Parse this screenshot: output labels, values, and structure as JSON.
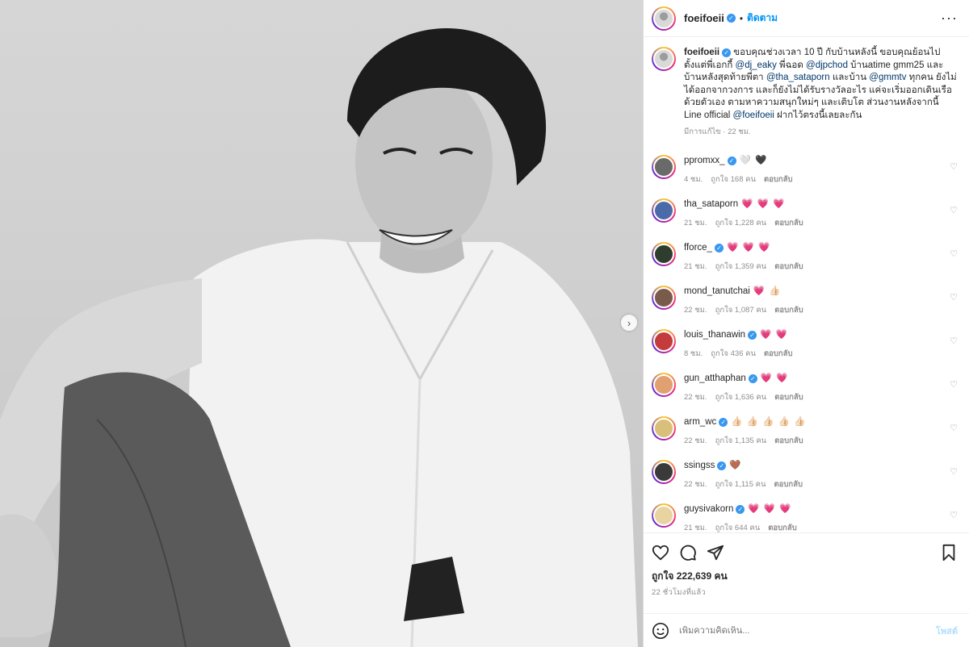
{
  "colors": {
    "accent": "#0095f6",
    "verified": "#3897f0",
    "heart": "#ed4956",
    "muted": "#8e8e8e"
  },
  "header": {
    "username": "foeifoeii",
    "dot": "•",
    "follow_label": "ติดตาม",
    "more_icon": "more-icon"
  },
  "caption": {
    "username": "foeifoeii",
    "parts": [
      "ขอบคุณช่วงเวลา 10 ปี กับบ้านหลังนี้ ขอบคุณย้อนไปตั้งแต่พี่เอกกี้ ",
      "@dj_eaky",
      " พี่ฉอด ",
      "@djpchod",
      " บ้านatime gmm25 และบ้านหลังสุดท้ายพี่ตา ",
      "@tha_sataporn",
      " และบ้าน ",
      "@gmmtv",
      " ทุกคน ยังไม่ได้ออกจากวงการ และก็ยังไม่ได้รับรางวัลอะไร แค่จะเริ่มออกเดินเรือด้วยตัวเอง ตามหาความสนุกใหม่ๆ และเติบโต ส่วนงานหลังจากนี้ Line official ",
      "@foeifoeii",
      " ฝากไว้ตรงนี้เลยละกัน"
    ],
    "edited": "มีการแก้ไข",
    "time": "22 ชม."
  },
  "comments": [
    {
      "user": "ppromxx_",
      "verified": true,
      "text": "🤍 🖤",
      "time": "4 ชม.",
      "likes": "ถูกใจ 168 คน",
      "reply": "ตอบกลับ"
    },
    {
      "user": "tha_sataporn",
      "verified": false,
      "text": "💗 💗 💗",
      "time": "21 ชม.",
      "likes": "ถูกใจ 1,228 คน",
      "reply": "ตอบกลับ"
    },
    {
      "user": "fforce_",
      "verified": true,
      "text": "💗 💗 💗",
      "time": "21 ชม.",
      "likes": "ถูกใจ 1,359 คน",
      "reply": "ตอบกลับ"
    },
    {
      "user": "mond_tanutchai",
      "verified": false,
      "text": "💗 👍🏻",
      "time": "22 ชม.",
      "likes": "ถูกใจ 1,087 คน",
      "reply": "ตอบกลับ"
    },
    {
      "user": "louis_thanawin",
      "verified": true,
      "text": "💗 💗",
      "time": "8 ชม.",
      "likes": "ถูกใจ 436 คน",
      "reply": "ตอบกลับ"
    },
    {
      "user": "gun_atthaphan",
      "verified": true,
      "text": "💗 💗",
      "time": "22 ชม.",
      "likes": "ถูกใจ 1,636 คน",
      "reply": "ตอบกลับ"
    },
    {
      "user": "arm_wc",
      "verified": true,
      "text": "👍🏻 👍🏻 👍🏻 👍🏻 👍🏻",
      "time": "22 ชม.",
      "likes": "ถูกใจ 1,135 คน",
      "reply": "ตอบกลับ"
    },
    {
      "user": "ssingss",
      "verified": true,
      "text": "🤎",
      "time": "22 ชม.",
      "likes": "ถูกใจ 1,115 คน",
      "reply": "ตอบกลับ"
    },
    {
      "user": "guysivakorn",
      "verified": true,
      "text": "💗 💗 💗",
      "time": "21 ชม.",
      "likes": "ถูกใจ 644 คน",
      "reply": "ตอบกลับ"
    }
  ],
  "actions": {
    "like_icon": "heart-icon",
    "comment_icon": "comment-icon",
    "share_icon": "share-icon",
    "save_icon": "bookmark-icon"
  },
  "likes": "ถูกใจ 222,639 คน",
  "time_ago": "22 ชั่วโมงที่แล้ว",
  "add_comment": {
    "placeholder": "เพิ่มความคิดเห็น...",
    "post_label": "โพสต์"
  },
  "photo": {
    "next_icon": "›"
  }
}
